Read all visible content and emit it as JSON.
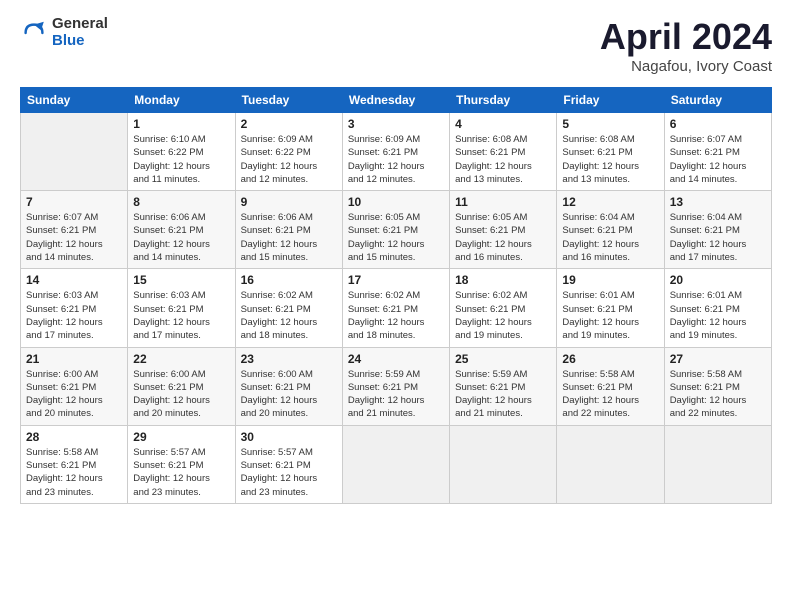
{
  "logo": {
    "general": "General",
    "blue": "Blue"
  },
  "title": {
    "month": "April 2024",
    "location": "Nagafou, Ivory Coast"
  },
  "weekdays": [
    "Sunday",
    "Monday",
    "Tuesday",
    "Wednesday",
    "Thursday",
    "Friday",
    "Saturday"
  ],
  "weeks": [
    [
      {
        "day": "",
        "info": ""
      },
      {
        "day": "1",
        "info": "Sunrise: 6:10 AM\nSunset: 6:22 PM\nDaylight: 12 hours\nand 11 minutes."
      },
      {
        "day": "2",
        "info": "Sunrise: 6:09 AM\nSunset: 6:22 PM\nDaylight: 12 hours\nand 12 minutes."
      },
      {
        "day": "3",
        "info": "Sunrise: 6:09 AM\nSunset: 6:21 PM\nDaylight: 12 hours\nand 12 minutes."
      },
      {
        "day": "4",
        "info": "Sunrise: 6:08 AM\nSunset: 6:21 PM\nDaylight: 12 hours\nand 13 minutes."
      },
      {
        "day": "5",
        "info": "Sunrise: 6:08 AM\nSunset: 6:21 PM\nDaylight: 12 hours\nand 13 minutes."
      },
      {
        "day": "6",
        "info": "Sunrise: 6:07 AM\nSunset: 6:21 PM\nDaylight: 12 hours\nand 14 minutes."
      }
    ],
    [
      {
        "day": "7",
        "info": "Sunrise: 6:07 AM\nSunset: 6:21 PM\nDaylight: 12 hours\nand 14 minutes."
      },
      {
        "day": "8",
        "info": "Sunrise: 6:06 AM\nSunset: 6:21 PM\nDaylight: 12 hours\nand 14 minutes."
      },
      {
        "day": "9",
        "info": "Sunrise: 6:06 AM\nSunset: 6:21 PM\nDaylight: 12 hours\nand 15 minutes."
      },
      {
        "day": "10",
        "info": "Sunrise: 6:05 AM\nSunset: 6:21 PM\nDaylight: 12 hours\nand 15 minutes."
      },
      {
        "day": "11",
        "info": "Sunrise: 6:05 AM\nSunset: 6:21 PM\nDaylight: 12 hours\nand 16 minutes."
      },
      {
        "day": "12",
        "info": "Sunrise: 6:04 AM\nSunset: 6:21 PM\nDaylight: 12 hours\nand 16 minutes."
      },
      {
        "day": "13",
        "info": "Sunrise: 6:04 AM\nSunset: 6:21 PM\nDaylight: 12 hours\nand 17 minutes."
      }
    ],
    [
      {
        "day": "14",
        "info": "Sunrise: 6:03 AM\nSunset: 6:21 PM\nDaylight: 12 hours\nand 17 minutes."
      },
      {
        "day": "15",
        "info": "Sunrise: 6:03 AM\nSunset: 6:21 PM\nDaylight: 12 hours\nand 17 minutes."
      },
      {
        "day": "16",
        "info": "Sunrise: 6:02 AM\nSunset: 6:21 PM\nDaylight: 12 hours\nand 18 minutes."
      },
      {
        "day": "17",
        "info": "Sunrise: 6:02 AM\nSunset: 6:21 PM\nDaylight: 12 hours\nand 18 minutes."
      },
      {
        "day": "18",
        "info": "Sunrise: 6:02 AM\nSunset: 6:21 PM\nDaylight: 12 hours\nand 19 minutes."
      },
      {
        "day": "19",
        "info": "Sunrise: 6:01 AM\nSunset: 6:21 PM\nDaylight: 12 hours\nand 19 minutes."
      },
      {
        "day": "20",
        "info": "Sunrise: 6:01 AM\nSunset: 6:21 PM\nDaylight: 12 hours\nand 19 minutes."
      }
    ],
    [
      {
        "day": "21",
        "info": "Sunrise: 6:00 AM\nSunset: 6:21 PM\nDaylight: 12 hours\nand 20 minutes."
      },
      {
        "day": "22",
        "info": "Sunrise: 6:00 AM\nSunset: 6:21 PM\nDaylight: 12 hours\nand 20 minutes."
      },
      {
        "day": "23",
        "info": "Sunrise: 6:00 AM\nSunset: 6:21 PM\nDaylight: 12 hours\nand 20 minutes."
      },
      {
        "day": "24",
        "info": "Sunrise: 5:59 AM\nSunset: 6:21 PM\nDaylight: 12 hours\nand 21 minutes."
      },
      {
        "day": "25",
        "info": "Sunrise: 5:59 AM\nSunset: 6:21 PM\nDaylight: 12 hours\nand 21 minutes."
      },
      {
        "day": "26",
        "info": "Sunrise: 5:58 AM\nSunset: 6:21 PM\nDaylight: 12 hours\nand 22 minutes."
      },
      {
        "day": "27",
        "info": "Sunrise: 5:58 AM\nSunset: 6:21 PM\nDaylight: 12 hours\nand 22 minutes."
      }
    ],
    [
      {
        "day": "28",
        "info": "Sunrise: 5:58 AM\nSunset: 6:21 PM\nDaylight: 12 hours\nand 23 minutes."
      },
      {
        "day": "29",
        "info": "Sunrise: 5:57 AM\nSunset: 6:21 PM\nDaylight: 12 hours\nand 23 minutes."
      },
      {
        "day": "30",
        "info": "Sunrise: 5:57 AM\nSunset: 6:21 PM\nDaylight: 12 hours\nand 23 minutes."
      },
      {
        "day": "",
        "info": ""
      },
      {
        "day": "",
        "info": ""
      },
      {
        "day": "",
        "info": ""
      },
      {
        "day": "",
        "info": ""
      }
    ]
  ]
}
